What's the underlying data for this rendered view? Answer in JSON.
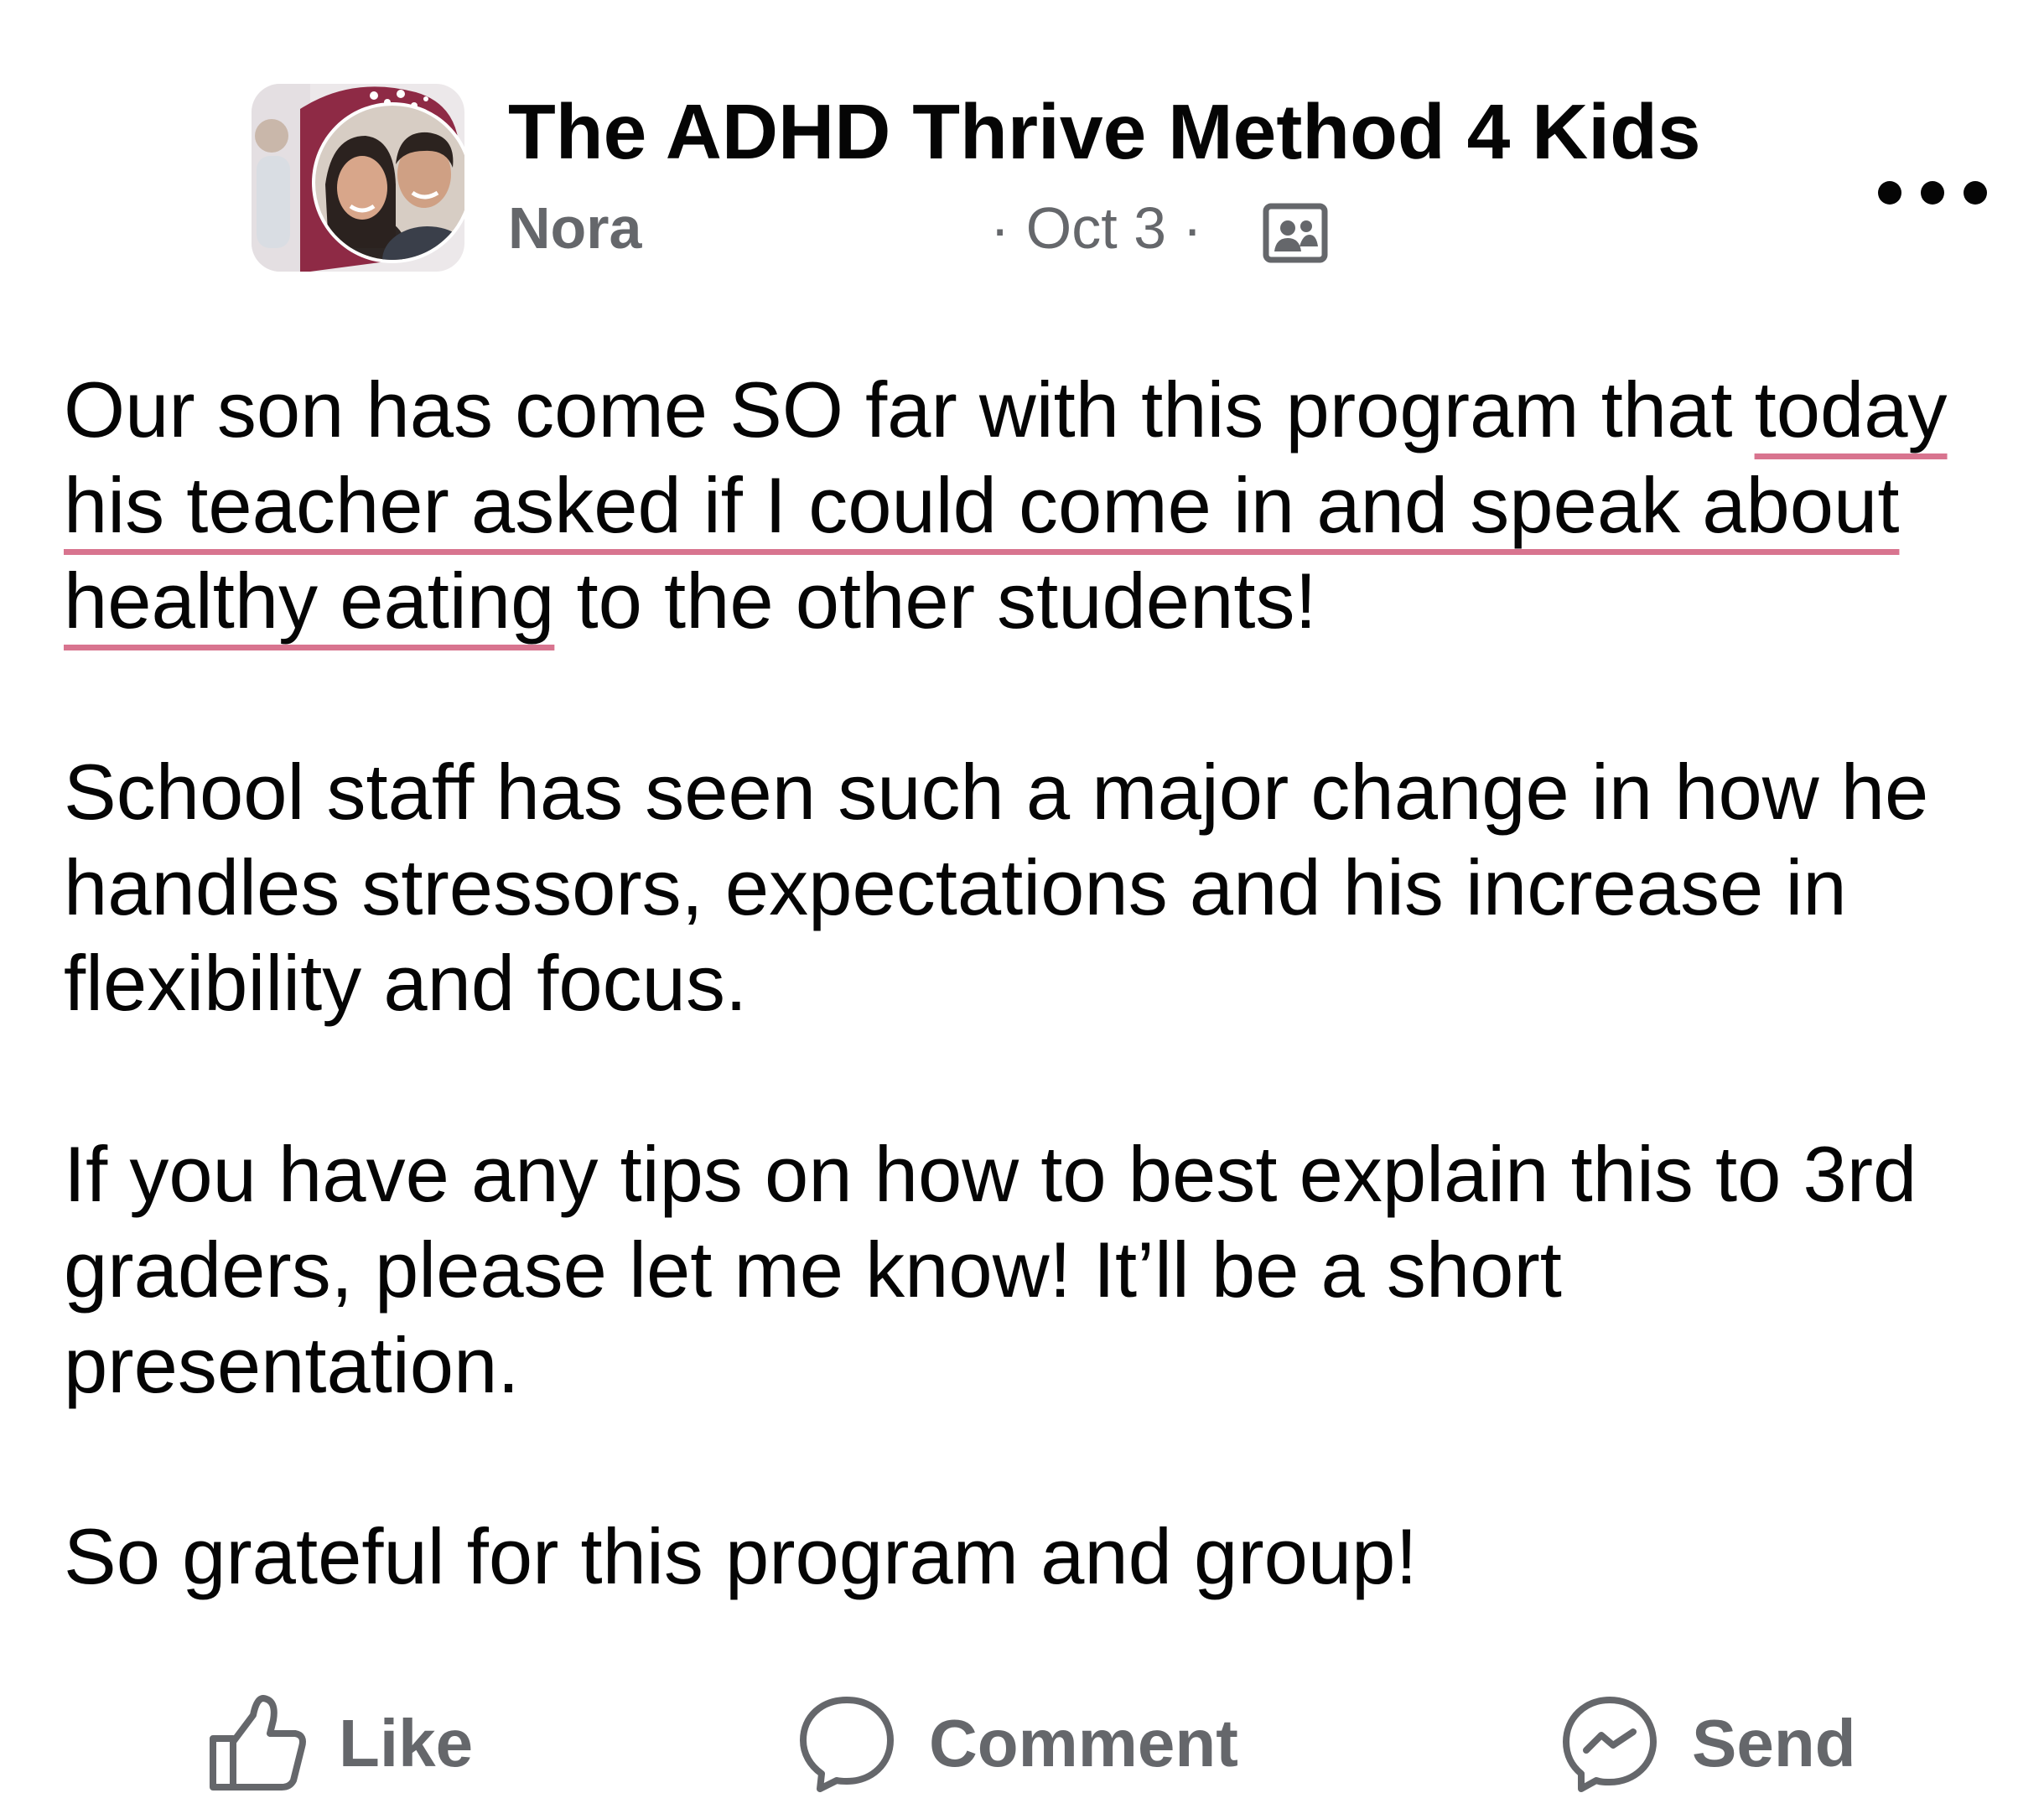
{
  "header": {
    "group_name": "The ADHD Thrive Method 4 Kids",
    "author": "Nora",
    "timestamp": "· Oct 3 ·",
    "audience_icon": "group-audience-icon",
    "more_icon": "more-options-icon"
  },
  "post": {
    "paragraphs": [
      {
        "plain_before": "Our son has come SO far with this program that ",
        "highlighted": "today his teacher asked if I could come in and speak about healthy eating",
        "plain_after": " to the other students!"
      },
      {
        "text": "School staff has seen such a major change in how he handles stressors, expectations and his increase in flexibility and focus."
      },
      {
        "text": "If you have any tips on how to best explain this to 3rd graders, please let me know! It’ll be a short presentation."
      },
      {
        "text": "So grateful for this program and group!"
      }
    ],
    "highlight_color": "#d8748f"
  },
  "actions": {
    "like": {
      "label": "Like",
      "icon": "thumbs-up-icon"
    },
    "comment": {
      "label": "Comment",
      "icon": "comment-bubble-icon"
    },
    "send": {
      "label": "Send",
      "icon": "messenger-icon"
    }
  },
  "colors": {
    "text_primary": "#050505",
    "text_secondary": "#65676b",
    "avatar_accent": "#8e2a45"
  }
}
